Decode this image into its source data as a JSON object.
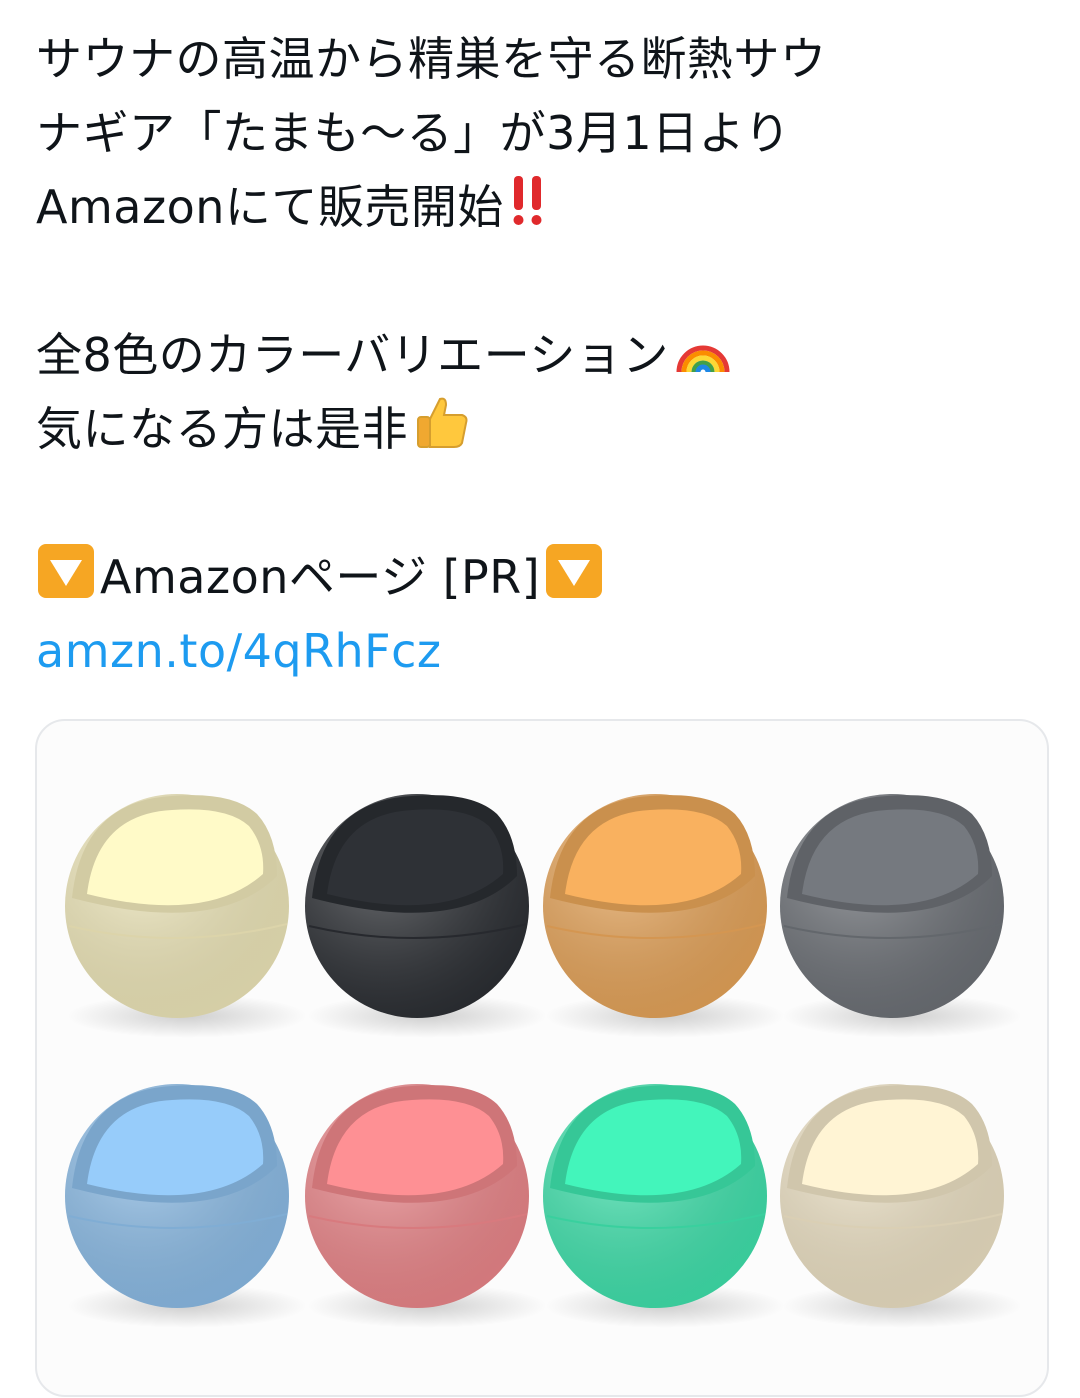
{
  "tweet": {
    "lines": [
      "サウナの高温から精巣を守る断熱サウ",
      "ナギア「たまも〜る」が3月1日より",
      "Amazonにて販売開始"
    ],
    "line_colors": "全8色のカラーバリエーション",
    "line_interest": "気になる方は是非",
    "line_amazon": "Amazonページ [PR]",
    "link": "amzn.to/4qRhFcz",
    "icons": {
      "exclaim": "double-exclamation-icon",
      "rainbow": "rainbow-icon",
      "thumb": "thumbs-up-icon",
      "down": "down-triangle-button-icon"
    },
    "colors": {
      "link": "#1d9bf0",
      "text": "#0f1419",
      "accent_orange": "#f6a623",
      "exclaim_red": "#e0292c"
    }
  },
  "media": {
    "product_colors": [
      "#f4ecbd",
      "#2b2e33",
      "#eba75a",
      "#6e7278",
      "#8ec0ec",
      "#f0888c",
      "#3fe7b0",
      "#f2e6c8"
    ]
  }
}
